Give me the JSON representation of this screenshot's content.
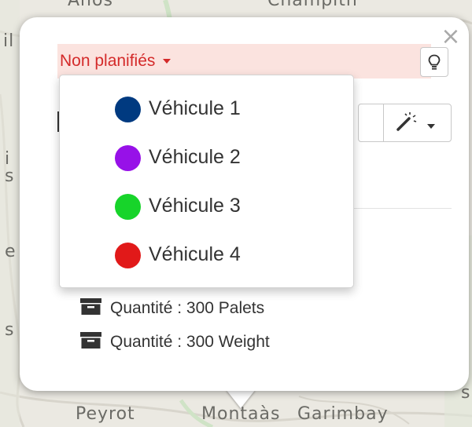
{
  "map": {
    "labels": {
      "top_left": "Anos",
      "top_right": "Champith",
      "bottom_left": "Peyrot",
      "bottom_center": "Montaàs",
      "bottom_right": "Garimbay",
      "edge_l1": "il",
      "edge_l2": "i",
      "edge_l3": "s",
      "edge_l4": "e",
      "edge_l5": "s",
      "edge_r": "s"
    }
  },
  "popup": {
    "close_symbol": "×",
    "status": {
      "label": "Non planifiés",
      "background": "#fbe3df",
      "color": "#d42a2a"
    },
    "hint_icon": "lightbulb-icon",
    "tools": {
      "icon": "magic-wand-icon"
    },
    "quantities": [
      {
        "icon": "archive-icon",
        "text": "Quantité : 300 Palets"
      },
      {
        "icon": "archive-icon",
        "text": "Quantité : 300 Weight"
      }
    ]
  },
  "vehicle_menu": {
    "items": [
      {
        "label": "Véhicule 1",
        "color": "#003a80"
      },
      {
        "label": "Véhicule 2",
        "color": "#9711e8"
      },
      {
        "label": "Véhicule 3",
        "color": "#17d42a"
      },
      {
        "label": "Véhicule 4",
        "color": "#e11919"
      }
    ]
  }
}
